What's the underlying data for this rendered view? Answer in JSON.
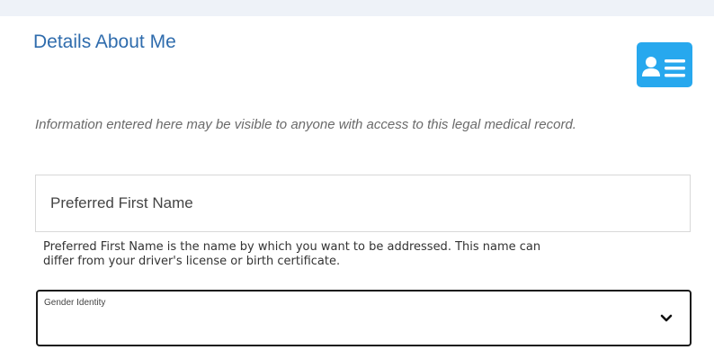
{
  "section": {
    "title": "Details About Me",
    "info_text": "Information entered here may be visible to anyone with access to this legal medical record.",
    "icon": "contact-card-icon"
  },
  "preferred_name": {
    "label": "Preferred First Name",
    "value": "",
    "help_line1": "Preferred First Name is the name by which you want to be addressed. This name can",
    "help_line2": "differ from your driver's license or birth certificate."
  },
  "gender_identity": {
    "label": "Gender Identity",
    "selected": "",
    "icon": "chevron-down-icon"
  },
  "colors": {
    "accent": "#2f6cad",
    "icon_bg": "#27a8ee"
  }
}
